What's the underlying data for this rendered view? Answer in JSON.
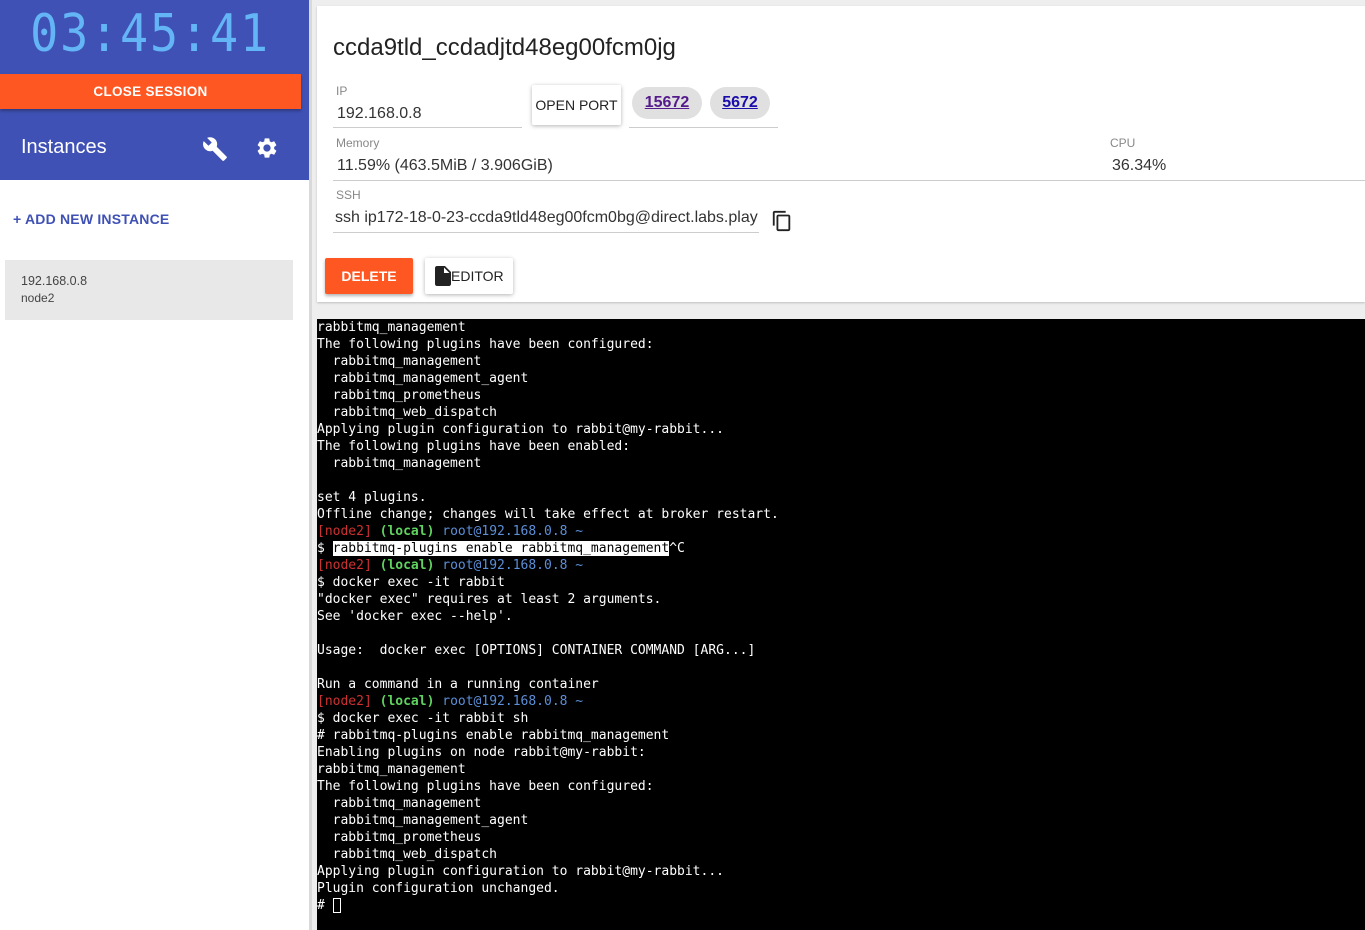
{
  "sidebar": {
    "timer": "03:45:41",
    "close_session": "CLOSE SESSION",
    "instances_title": "Instances",
    "add_instance": "+ ADD NEW INSTANCE",
    "instance": {
      "ip": "192.168.0.8",
      "name": "node2"
    }
  },
  "card": {
    "title": "ccda9tld_ccdadjtd48eg00fcm0jg",
    "ip_label": "IP",
    "ip_value": "192.168.0.8",
    "open_port": "OPEN PORT",
    "ports": [
      "15672",
      "5672"
    ],
    "memory_label": "Memory",
    "memory_value": "11.59% (463.5MiB / 3.906GiB)",
    "cpu_label": "CPU",
    "cpu_value": "36.34%",
    "ssh_label": "SSH",
    "ssh_value": "ssh ip172-18-0-23-ccda9tld48eg00fcm0bg@direct.labs.play",
    "delete": "DELETE",
    "editor": "EDITOR"
  },
  "terminal": {
    "prompt_node": "[node2]",
    "prompt_local": "(local)",
    "prompt_host": "root@192.168.0.8 ~",
    "selected_cmd": "rabbitmq-plugins enable rabbitmq_management",
    "interrupt": "^C",
    "lines_a": [
      "rabbitmq_management",
      "The following plugins have been configured:",
      "  rabbitmq_management",
      "  rabbitmq_management_agent",
      "  rabbitmq_prometheus",
      "  rabbitmq_web_dispatch",
      "Applying plugin configuration to rabbit@my-rabbit...",
      "The following plugins have been enabled:",
      "  rabbitmq_management",
      "",
      "set 4 plugins.",
      "Offline change; changes will take effect at broker restart."
    ],
    "lines_b": [
      "$ docker exec -it rabbit",
      "\"docker exec\" requires at least 2 arguments.",
      "See 'docker exec --help'.",
      "",
      "Usage:  docker exec [OPTIONS] CONTAINER COMMAND [ARG...]",
      "",
      "Run a command in a running container"
    ],
    "lines_c": [
      "$ docker exec -it rabbit sh",
      "# rabbitmq-plugins enable rabbitmq_management",
      "Enabling plugins on node rabbit@my-rabbit:",
      "rabbitmq_management",
      "The following plugins have been configured:",
      "  rabbitmq_management",
      "  rabbitmq_management_agent",
      "  rabbitmq_prometheus",
      "  rabbitmq_web_dispatch",
      "Applying plugin configuration to rabbit@my-rabbit...",
      "Plugin configuration unchanged."
    ],
    "final_prompt": "# "
  }
}
